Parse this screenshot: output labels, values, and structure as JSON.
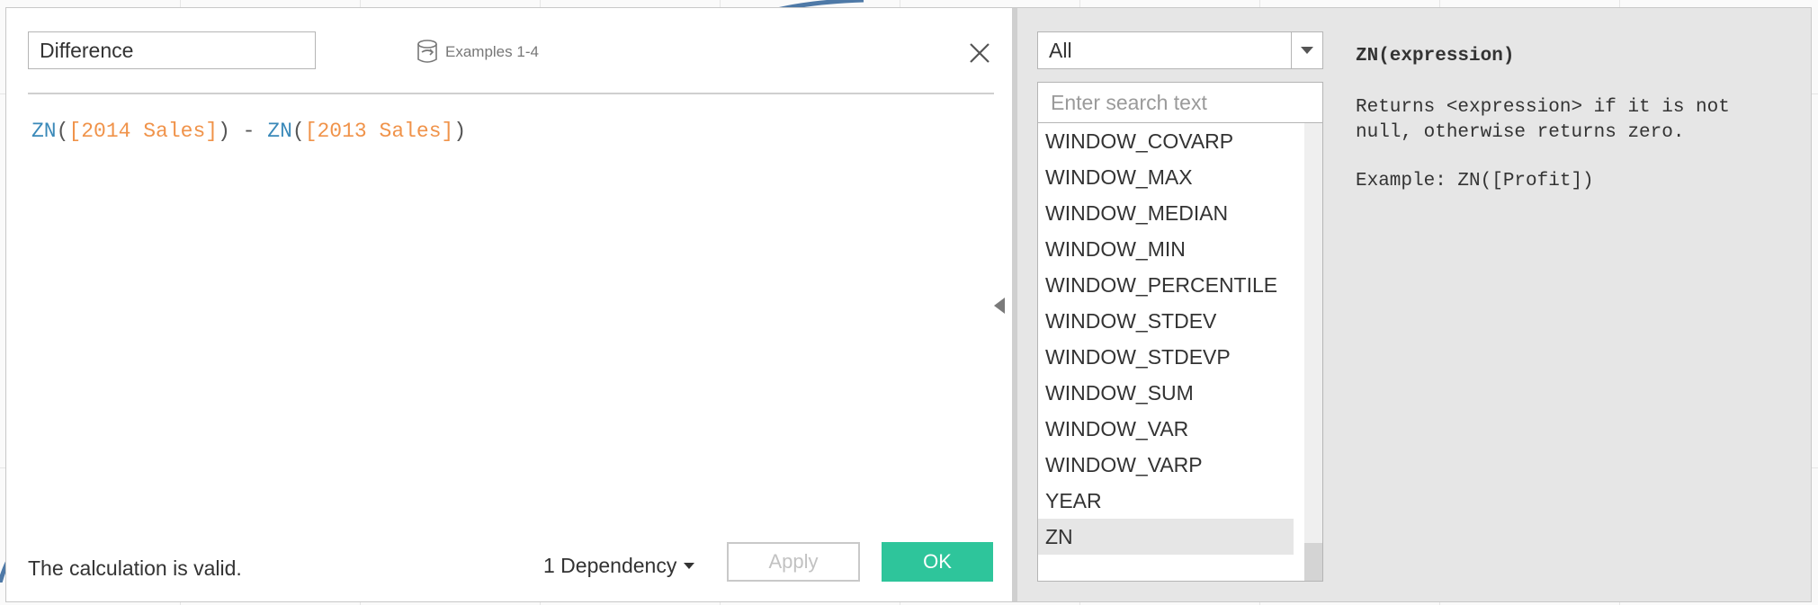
{
  "calc_name": "Difference",
  "examples_label": "Examples 1-4",
  "formula": {
    "tokens": [
      {
        "type": "fn",
        "text": "ZN"
      },
      {
        "type": "op",
        "text": "("
      },
      {
        "type": "field",
        "text": "[2014 Sales]"
      },
      {
        "type": "op",
        "text": ") - "
      },
      {
        "type": "fn",
        "text": "ZN"
      },
      {
        "type": "op",
        "text": "("
      },
      {
        "type": "field",
        "text": "[2013 Sales]"
      },
      {
        "type": "op",
        "text": ")"
      }
    ]
  },
  "status_text": "The calculation is valid.",
  "dependency_label": "1 Dependency",
  "apply_label": "Apply",
  "ok_label": "OK",
  "category": {
    "selected": "All"
  },
  "search": {
    "placeholder": "Enter search text",
    "value": ""
  },
  "functions": {
    "items": [
      "WINDOW_COVARP",
      "WINDOW_MAX",
      "WINDOW_MEDIAN",
      "WINDOW_MIN",
      "WINDOW_PERCENTILE",
      "WINDOW_STDEV",
      "WINDOW_STDEVP",
      "WINDOW_SUM",
      "WINDOW_VAR",
      "WINDOW_VARP",
      "YEAR",
      "ZN"
    ],
    "selected": "ZN"
  },
  "help": {
    "signature": "ZN(expression)",
    "description": "Returns <expression> if it is not null, otherwise returns zero.",
    "example": "Example: ZN([Profit])"
  },
  "colors": {
    "accent": "#2ec59b",
    "function_token": "#3a89b9",
    "field_token": "#f0934a"
  },
  "icons": [
    "examples-icon",
    "close-icon",
    "chevron-down-icon",
    "collapse-left-icon"
  ]
}
